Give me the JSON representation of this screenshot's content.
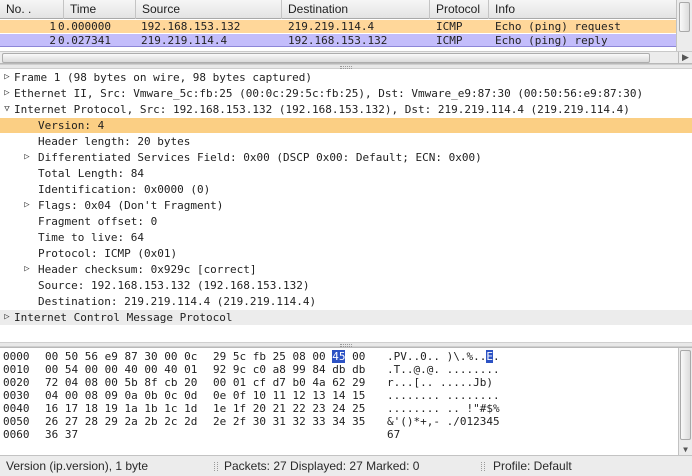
{
  "packet_list": {
    "columns": [
      "No. .",
      "Time",
      "Source",
      "Destination",
      "Protocol",
      "Info"
    ],
    "rows": [
      {
        "no": "1",
        "time": "0.000000",
        "source": "192.168.153.132",
        "destination": "219.219.114.4",
        "protocol": "ICMP",
        "info": "Echo (ping) request"
      },
      {
        "no": "2",
        "time": "0.027341",
        "source": "219.219.114.4",
        "destination": "192.168.153.132",
        "protocol": "ICMP",
        "info": "Echo (ping) reply"
      }
    ],
    "row_colors": [
      "#ffd79a",
      "#c3bdfb"
    ]
  },
  "details": {
    "lines": [
      {
        "arrow": "▷",
        "text": "Frame 1 (98 bytes on wire, 98 bytes captured)"
      },
      {
        "arrow": "▷",
        "text": "Ethernet II, Src: Vmware_5c:fb:25 (00:0c:29:5c:fb:25), Dst: Vmware_e9:87:30 (00:50:56:e9:87:30)"
      },
      {
        "arrow": "▽",
        "text": "Internet Protocol, Src: 192.168.153.132 (192.168.153.132), Dst: 219.219.114.4 (219.219.114.4)"
      },
      {
        "arrow": "",
        "text": "Version: 4"
      },
      {
        "arrow": "",
        "text": "Header length: 20 bytes"
      },
      {
        "arrow": "▷",
        "text": "Differentiated Services Field: 0x00 (DSCP 0x00: Default; ECN: 0x00)"
      },
      {
        "arrow": "",
        "text": "Total Length: 84"
      },
      {
        "arrow": "",
        "text": "Identification: 0x0000 (0)"
      },
      {
        "arrow": "▷",
        "text": "Flags: 0x04 (Don't Fragment)"
      },
      {
        "arrow": "",
        "text": "Fragment offset: 0"
      },
      {
        "arrow": "",
        "text": "Time to live: 64"
      },
      {
        "arrow": "",
        "text": "Protocol: ICMP (0x01)"
      },
      {
        "arrow": "▷",
        "text": "Header checksum: 0x929c [correct]"
      },
      {
        "arrow": "",
        "text": "Source: 192.168.153.132 (192.168.153.132)"
      },
      {
        "arrow": "",
        "text": "Destination: 219.219.114.4 (219.219.114.4)"
      },
      {
        "arrow": "▷",
        "text": "Internet Control Message Protocol"
      }
    ],
    "selected_line": "Version: 4",
    "selection_color": "#fbcf84"
  },
  "hex": {
    "rows": [
      {
        "offset": "0000",
        "bytes_a": "00 50 56 e9 87 30 00 0c",
        "bytes_b_pre": "29 5c fb 25 08 00 ",
        "bytes_b_hl": "45",
        "bytes_b_post": " 00",
        "ascii_pre": ".PV..0.. )\\.%..",
        "ascii_hl": "E",
        "ascii_post": "."
      },
      {
        "offset": "0010",
        "bytes_a": "00 54 00 00 40 00 40 01",
        "bytes_b": "92 9c c0 a8 99 84 db db",
        "ascii": ".T..@.@. ........"
      },
      {
        "offset": "0020",
        "bytes_a": "72 04 08 00 5b 8f cb 20",
        "bytes_b": "00 01 cf d7 b0 4a 62 29",
        "ascii": "r...[.. .....Jb)"
      },
      {
        "offset": "0030",
        "bytes_a": "04 00 08 09 0a 0b 0c 0d",
        "bytes_b": "0e 0f 10 11 12 13 14 15",
        "ascii": "........ ........"
      },
      {
        "offset": "0040",
        "bytes_a": "16 17 18 19 1a 1b 1c 1d",
        "bytes_b": "1e 1f 20 21 22 23 24 25",
        "ascii": "........ .. !\"#$%"
      },
      {
        "offset": "0050",
        "bytes_a": "26 27 28 29 2a 2b 2c 2d",
        "bytes_b": "2e 2f 30 31 32 33 34 35",
        "ascii": "&'()*+,- ./012345"
      },
      {
        "offset": "0060",
        "bytes_a": "36 37",
        "bytes_b": "",
        "ascii": "67"
      }
    ],
    "highlight_color": "#2c52c4"
  },
  "status_bar": {
    "field": "Version (ip.version), 1 byte",
    "packets": "Packets: 27 Displayed: 27 Marked: 0",
    "profile": "Profile: Default"
  }
}
